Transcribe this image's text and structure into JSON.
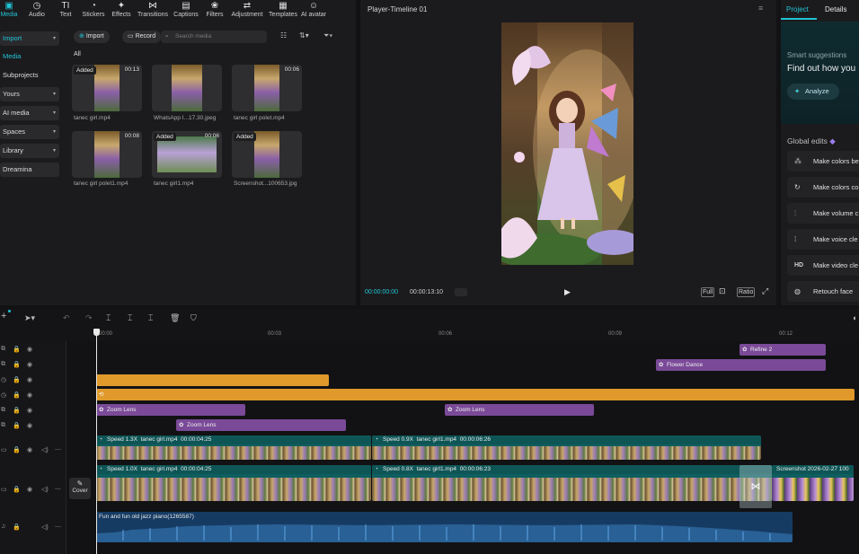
{
  "toolbar": {
    "items": [
      {
        "label": "Media",
        "icon": "media-icon"
      },
      {
        "label": "Audio",
        "icon": "audio-icon"
      },
      {
        "label": "Text",
        "icon": "text-icon"
      },
      {
        "label": "Stickers",
        "icon": "stickers-icon"
      },
      {
        "label": "Effects",
        "icon": "effects-icon"
      },
      {
        "label": "Transitions",
        "icon": "transitions-icon"
      },
      {
        "label": "Captions",
        "icon": "captions-icon"
      },
      {
        "label": "Filters",
        "icon": "filters-icon"
      },
      {
        "label": "Adjustment",
        "icon": "adjustment-icon"
      },
      {
        "label": "Templates",
        "icon": "templates-icon"
      },
      {
        "label": "AI avatar",
        "icon": "ai-avatar-icon"
      }
    ]
  },
  "leftnav": {
    "import": "Import",
    "media": "Media",
    "subprojects": "Subprojects",
    "yours": "Yours",
    "ai_media": "AI media",
    "spaces": "Spaces",
    "library": "Library",
    "dreamina": "Dreamina"
  },
  "media": {
    "import_btn": "Import",
    "record_btn": "Record",
    "search_placeholder": "Search media",
    "filter_all": "All",
    "items": [
      {
        "name": "tanec girl.mp4",
        "badge": "Added",
        "duration": "00:13"
      },
      {
        "name": "WhatsApp I...17.30.jpeg",
        "badge": "",
        "duration": ""
      },
      {
        "name": "tanec girl polet.mp4",
        "badge": "",
        "duration": "00:06"
      },
      {
        "name": "tanec girl polet1.mp4",
        "badge": "",
        "duration": "00:08"
      },
      {
        "name": "tanec girl1.mp4",
        "badge": "Added",
        "duration": "00:06"
      },
      {
        "name": "Screenshot...100653.jpg",
        "badge": "Added",
        "duration": ""
      }
    ]
  },
  "player": {
    "title": "Player-Timeline 01",
    "current_time": "00:00:00:00",
    "total_time": "00:00:13:10",
    "full": "Full",
    "ratio": "Ratio"
  },
  "right_panel": {
    "tab_project": "Project",
    "tab_details": "Details",
    "smart_title": "Smart suggestions",
    "smart_sub": "Find out how you",
    "analyze": "Analyze",
    "global_edits": "Global edits",
    "edits": [
      {
        "label": "Make colors be",
        "icon": "magic-wand-icon"
      },
      {
        "label": "Make colors co",
        "icon": "color-icon"
      },
      {
        "label": "Make volume c",
        "icon": "volume-icon"
      },
      {
        "label": "Make voice cle",
        "icon": "voice-icon"
      },
      {
        "label": "Make video cle",
        "icon": "hd-icon"
      },
      {
        "label": "Retouch face",
        "icon": "retouch-icon"
      }
    ]
  },
  "timeline": {
    "ruler": [
      "00:00",
      "00:03",
      "00:06",
      "00:09",
      "00:12"
    ],
    "cover": "Cover",
    "effects": {
      "refine": "Refine 2",
      "flower": "Flower Dance",
      "zoom1": "Zoom Lens",
      "zoom2": "Zoom Lens",
      "zoom3": "Zoom Lens"
    },
    "overlay1": {
      "a_speed": "Speed 1.3X",
      "a_name": "tanec girl.mp4",
      "a_dur": "00:00:04:25",
      "b_speed": "Speed 0.9X",
      "b_name": "tanec girl1.mp4",
      "b_dur": "00:00:06:26"
    },
    "main": {
      "a_speed": "Speed 1.0X",
      "a_name": "tanec girl.mp4",
      "a_dur": "00:00:04:25",
      "b_speed": "Speed 0.8X",
      "b_name": "tanec girl1.mp4",
      "b_dur": "00:00:06:23",
      "c_name": "Screenshot 2026-02-27 100"
    },
    "audio": "Fun and fun old jazz piano(1265587)"
  },
  "colors": {
    "accent": "#22c4d6",
    "effect_clip": "#7a4a98",
    "text_clip": "#df9a2b",
    "video_clip": "#0f5f60",
    "audio_clip": "#163b63"
  }
}
